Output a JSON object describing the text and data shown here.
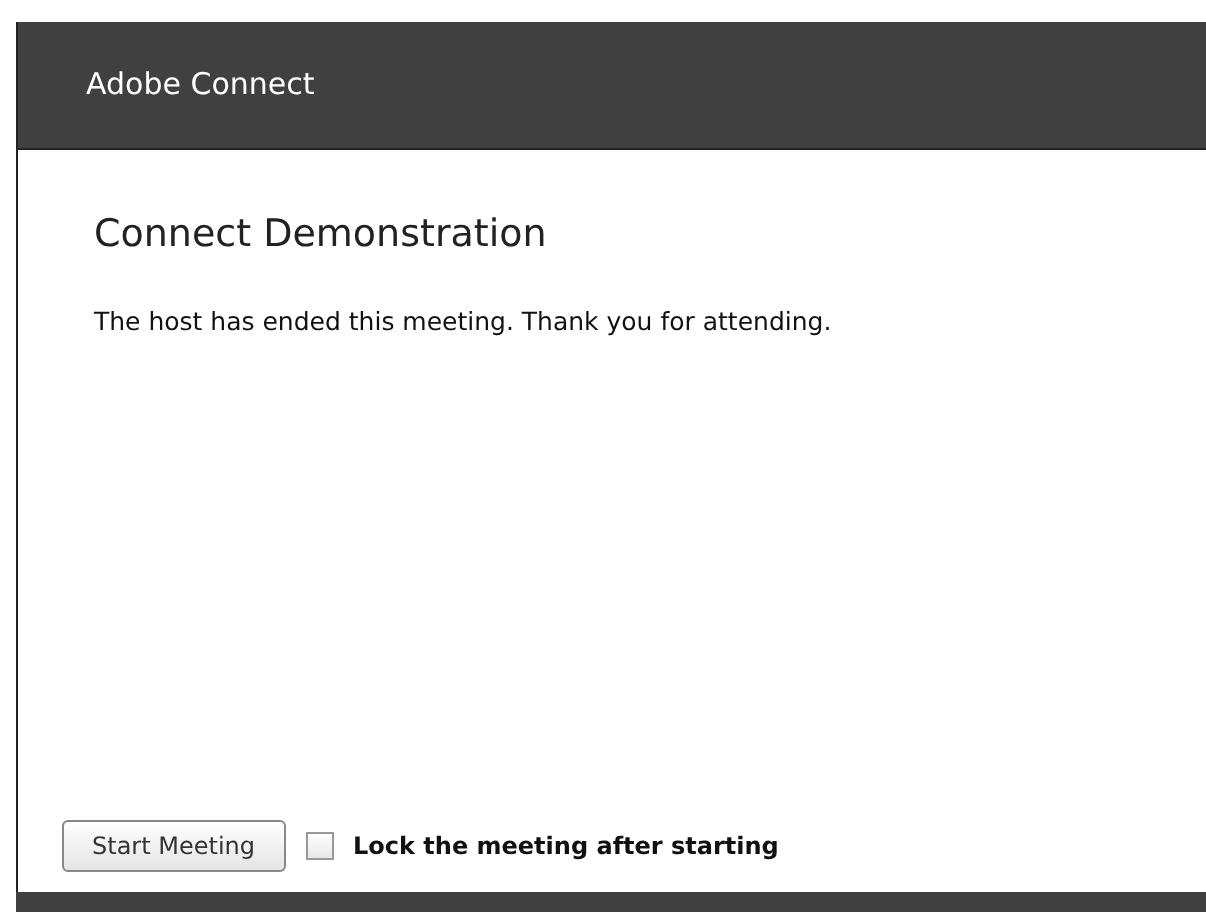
{
  "header": {
    "title": "Adobe Connect"
  },
  "dialog": {
    "title": "Connect Demonstration",
    "message": "The host has ended this meeting. Thank you for attending."
  },
  "footer": {
    "button": "Start Meeting",
    "checkbox": {
      "label": "Lock the meeting after starting",
      "checked": false
    }
  }
}
